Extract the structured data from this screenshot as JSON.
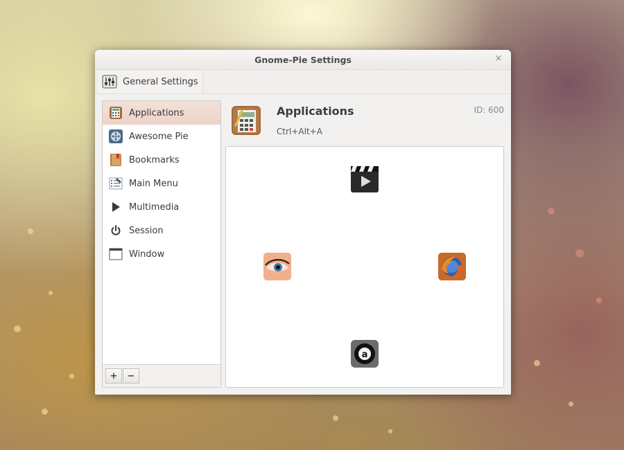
{
  "window": {
    "title": "Gnome-Pie Settings",
    "close_glyph": "×"
  },
  "toolbar": {
    "tab_label": "General Settings",
    "tab_icon": "sliders-icon"
  },
  "sidebar": {
    "items": [
      {
        "label": "Applications",
        "icon": "calculator-icon",
        "selected": true
      },
      {
        "label": "Awesome Pie",
        "icon": "film-reel-icon",
        "selected": false
      },
      {
        "label": "Bookmarks",
        "icon": "bookmark-book-icon",
        "selected": false
      },
      {
        "label": "Main Menu",
        "icon": "main-menu-icon",
        "selected": false
      },
      {
        "label": "Multimedia",
        "icon": "play-icon",
        "selected": false
      },
      {
        "label": "Session",
        "icon": "power-icon",
        "selected": false
      },
      {
        "label": "Window",
        "icon": "window-icon",
        "selected": false
      }
    ],
    "add_label": "+",
    "remove_label": "−"
  },
  "pie": {
    "name": "Applications",
    "hotkey": "Ctrl+Alt+A",
    "id_label": "ID: 600",
    "slices": [
      {
        "icon": "video-player-icon"
      },
      {
        "icon": "firefox-icon"
      },
      {
        "icon": "amarok-icon"
      },
      {
        "icon": "eye-viewer-icon"
      }
    ]
  },
  "colors": {
    "selection": "#ecd3c8",
    "window_bg": "#f2f1f0"
  }
}
